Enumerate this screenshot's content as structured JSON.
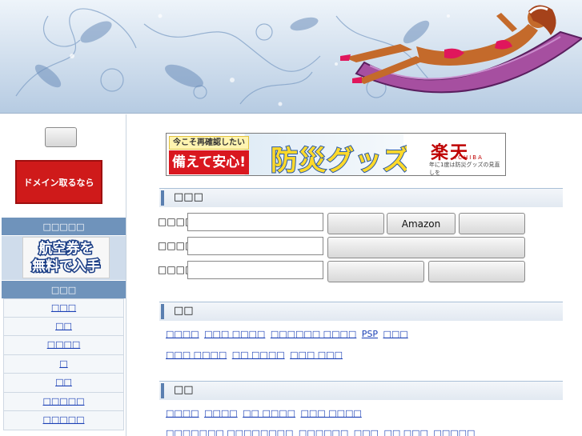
{
  "header": {
    "colors": {
      "sky": "#cfdced",
      "lounger": "#a64fa0",
      "bikini": "#e0165c",
      "skin": "#c46a2b"
    }
  },
  "sidebar": {
    "blank_button": "",
    "domain_banner": "ドメイン取るなら",
    "section1_title": "□□□□□",
    "ticket_banner": {
      "line1": "航空券を",
      "line2": "無料で入手"
    },
    "section2_title": "□□□",
    "nav_items": [
      "□□□",
      "□□",
      "□□□□",
      "□",
      "□□",
      "□□□□□",
      "□□□□□"
    ]
  },
  "main": {
    "promo": {
      "top_text": "今こそ再確認したい",
      "badge_text": "備えて安心!",
      "headline": "防災グッズ",
      "shop_logo": "楽天",
      "shop_sub": "ICHIBA",
      "footer_text": "年に1度は防災グッズの見直しを"
    },
    "search": {
      "title": "□□□",
      "rows": [
        {
          "label": "□□□□",
          "value": "",
          "buttons": [
            "",
            "Amazon",
            ""
          ]
        },
        {
          "label": "□□□□",
          "value": "",
          "buttons": [
            ""
          ]
        },
        {
          "label": "□□□□",
          "value": "",
          "buttons": [
            "",
            ""
          ]
        }
      ]
    },
    "section2": {
      "title": "□□",
      "line1": [
        "□□□□",
        "□□□ □□□□",
        "□□□□□□ □□□□",
        "PSP",
        "□□□"
      ],
      "line2": [
        "□□□ □□□□",
        "□□ □□□□",
        "□□□ □□□"
      ]
    },
    "section3": {
      "title": "□□",
      "line1": [
        "□□□□",
        "□□□□",
        "□□ □□□□",
        "□□□ □□□□"
      ],
      "line2": [
        "□□□□□□□ □□□□□□□□",
        "□□□□□□",
        "□□□",
        "□□ □□□",
        "□□□□□"
      ]
    }
  }
}
